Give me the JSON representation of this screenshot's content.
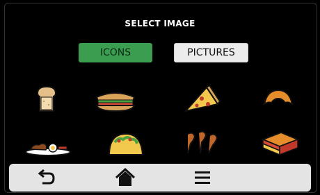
{
  "header": {
    "title": "SELECT IMAGE"
  },
  "tabs": [
    {
      "label": "ICONS",
      "active": true,
      "color": "#3a9d4f"
    },
    {
      "label": "PICTURES",
      "active": false,
      "color": "#ececec"
    }
  ],
  "icons": [
    {
      "icon": "toast-icon"
    },
    {
      "icon": "sandwich-icon"
    },
    {
      "icon": "pizza-slice-icon"
    },
    {
      "icon": "croissant-icon"
    },
    {
      "icon": "breakfast-plate-icon"
    },
    {
      "icon": "taco-icon"
    },
    {
      "icon": "chicken-wings-icon"
    },
    {
      "icon": "lasagna-icon"
    }
  ],
  "navbar": {
    "items": [
      {
        "icon": "back-arrow-icon"
      },
      {
        "icon": "home-icon"
      },
      {
        "icon": "menu-icon"
      }
    ]
  }
}
